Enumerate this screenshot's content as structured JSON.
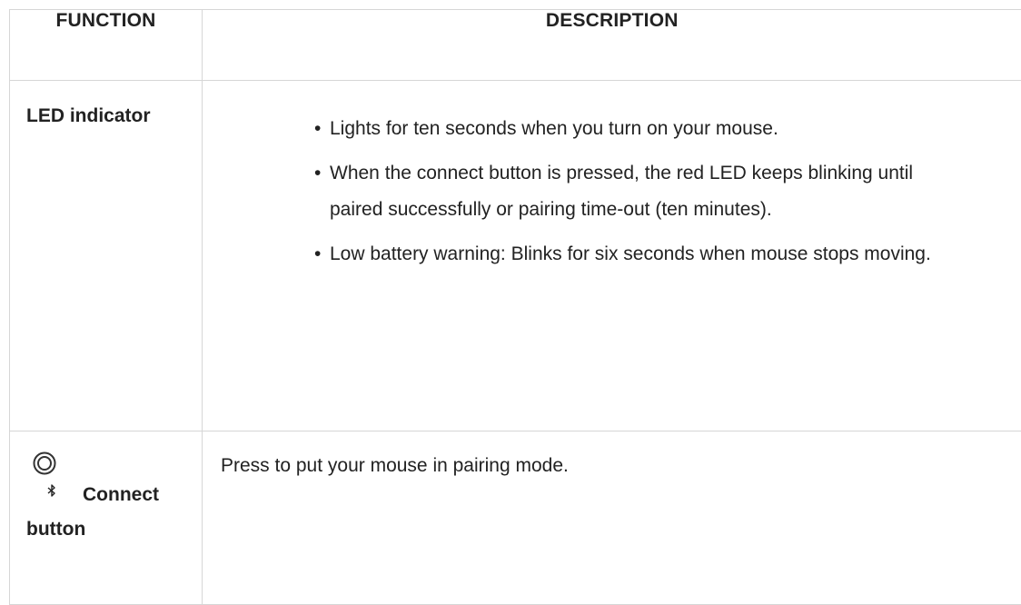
{
  "table": {
    "headers": {
      "function": "FUNCTION",
      "description": "DESCRIPTION"
    },
    "rows": [
      {
        "function": "LED indicator",
        "description_items": [
          "Lights for ten seconds when you turn on your mouse.",
          "When the connect button is pressed, the red LED keeps blinking until paired successfully or pairing time-out (ten minutes).",
          "Low battery warning: Blinks for six seconds when mouse stops moving."
        ]
      },
      {
        "function_icons": [
          "connect-ring-icon",
          "bluetooth-icon"
        ],
        "function_line1": "Connect",
        "function_line2": "button",
        "description": "Press to put your mouse in pairing mode."
      }
    ]
  }
}
